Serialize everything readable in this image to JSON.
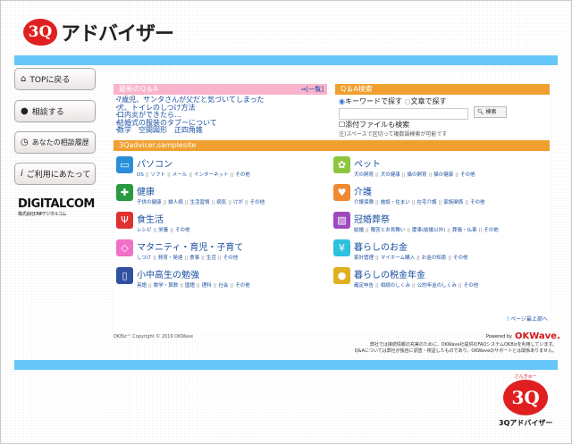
{
  "header": {
    "logo_mark": "3Q",
    "logo_text": "アドバイザー"
  },
  "sidebar": {
    "items": [
      {
        "label": "TOPに戻る",
        "icon": "home-icon"
      },
      {
        "label": "相談する",
        "icon": "speech-bubble-icon"
      },
      {
        "label": "あなたの相談履歴",
        "icon": "clock-icon"
      },
      {
        "label": "ご利用にあたって",
        "icon": "info-icon"
      }
    ],
    "sponsor": "DIGITALCOM",
    "sponsor_sub": "株式会社DNPデジタルコム"
  },
  "latest": {
    "title": "最新のQ＆A",
    "more": "⇒[一覧]",
    "items": [
      "7歳児、サンタさんが父だと気づいてしまった",
      "犬、トイレのしつけ方法",
      "口内炎ができたら…",
      "結婚式の服装のタブーについて",
      "数学　空間図形　正四角錐"
    ]
  },
  "search": {
    "title": "Q＆A検索",
    "radio1": "キーワードで探す",
    "radio2": "文章で探す",
    "input_value": "",
    "button": "検索",
    "attach": "添付ファイルも検索",
    "note": "注)スペースで区切って複数語検索が可能です"
  },
  "site": {
    "title": "3Qadvicer.samplesite"
  },
  "categories": [
    {
      "name": "パソコン",
      "subs": [
        "OS",
        "ソフト",
        "メール",
        "インターネット",
        "その他"
      ],
      "color": "#2a8fd8",
      "icon": "computer-icon"
    },
    {
      "name": "ペット",
      "subs": [
        "犬の飼育",
        "犬の健康",
        "猫の飼育",
        "猫の健康",
        "その他"
      ],
      "color": "#8cc63f",
      "icon": "paw-icon"
    },
    {
      "name": "健康",
      "subs": [
        "子供の健康",
        "婦人病",
        "生活習慣",
        "病気",
        "けが",
        "その他"
      ],
      "color": "#2a9a40",
      "icon": "first-aid-icon"
    },
    {
      "name": "介護",
      "subs": [
        "介護保険",
        "施設・住まい",
        "在宅介護",
        "家族関係",
        "その他"
      ],
      "color": "#f08a30",
      "icon": "hands-heart-icon"
    },
    {
      "name": "食生活",
      "subs": [
        "レシピ",
        "栄養",
        "その他"
      ],
      "color": "#e03030",
      "icon": "fork-knife-icon"
    },
    {
      "name": "冠婚葬祭",
      "subs": [
        "結婚",
        "贈答とお見舞い",
        "慶事(結婚以外)",
        "葬儀・仏事",
        "その他"
      ],
      "color": "#a048c0",
      "icon": "gift-icon"
    },
    {
      "name": "マタニティ・育児・子育て",
      "subs": [
        "しつけ",
        "発育・発達",
        "食事",
        "生活",
        "その他"
      ],
      "color": "#f070c8",
      "icon": "baby-bottle-icon"
    },
    {
      "name": "暮らしのお金",
      "subs": [
        "家計管理",
        "マイホーム購入",
        "お金の知恵",
        "その他"
      ],
      "color": "#30c0e0",
      "icon": "yen-icon"
    },
    {
      "name": "小中高生の勉強",
      "subs": [
        "英語",
        "数学・算数",
        "国語",
        "理科",
        "社会",
        "その他"
      ],
      "color": "#3050a0",
      "icon": "book-icon"
    },
    {
      "name": "暮らしの税金年金",
      "subs": [
        "確定申告",
        "相続のしくみ",
        "公的年金のしくみ",
        "その他"
      ],
      "color": "#e0b020",
      "icon": "money-bag-icon"
    }
  ],
  "footer": {
    "page_top": "ページ最上部へ",
    "copyright": "OKBiz™ Copyright © 2019 OKWave",
    "powered": "Powered by",
    "powered_brand": "OKWave.",
    "disclaimer1": "弊社では接続情報の充実のために、OKWave社提供のFAQシステムOKBizを利用しています。",
    "disclaimer2": "Q&Aについては弊社が独自に調査・検証したものであり、OKWaveのサポートとは関係ありません。"
  },
  "footer_logo": {
    "mark": "3Q",
    "text": "3Qアドバイザー",
    "tagline": "さんきゅー"
  }
}
